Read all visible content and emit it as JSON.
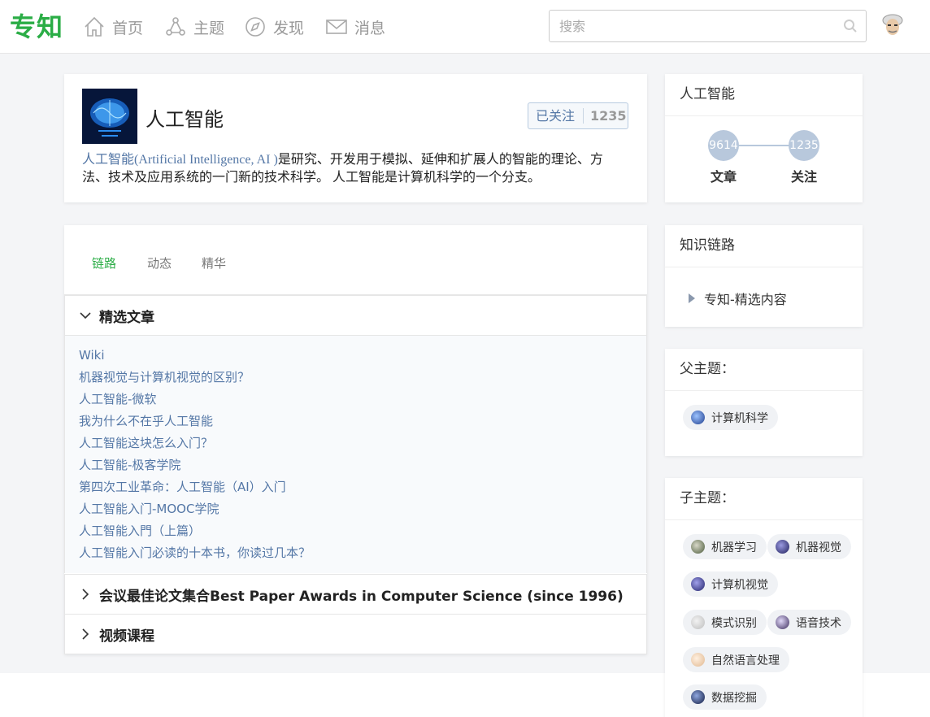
{
  "header": {
    "logo": "专知",
    "nav": [
      {
        "label": "首页",
        "icon": "home-icon"
      },
      {
        "label": "主题",
        "icon": "topic-icon"
      },
      {
        "label": "发现",
        "icon": "compass-icon"
      },
      {
        "label": "消息",
        "icon": "mail-icon"
      }
    ],
    "search": {
      "placeholder": "搜索",
      "value": ""
    }
  },
  "topic": {
    "title": "人工智能",
    "follow_label": "已关注",
    "follow_count": "1235",
    "desc_link": "人工智能",
    "desc_link_en": "(Artificial Intelligence, AI )",
    "desc_rest": "是研究、开发用于模拟、延伸和扩展人的智能的理论、方法、技术及应用系统的一门新的技术科学。 人工智能是计算机科学的一个分支。"
  },
  "tabs": [
    {
      "label": "链路",
      "active": true
    },
    {
      "label": "动态",
      "active": false
    },
    {
      "label": "精华",
      "active": false
    }
  ],
  "sections": [
    {
      "title": "精选文章",
      "expanded": true,
      "items": [
        "Wiki",
        "机器视觉与计算机视觉的区别？",
        "人工智能-微软",
        "我为什么不在乎人工智能",
        "人工智能这块怎么入门？",
        "人工智能-极客学院",
        "第四次工业革命：人工智能（AI）入门",
        "人工智能入门-MOOC学院",
        "人工智能入門（上篇）",
        "人工智能入门必读的十本书，你读过几本？"
      ]
    },
    {
      "title": "会议最佳论文集合Best Paper Awards in Computer Science (since 1996)",
      "expanded": false
    },
    {
      "title": "视频课程",
      "expanded": false
    }
  ],
  "sidebar": {
    "stats_card": {
      "title": "人工智能",
      "articles_value": "9614",
      "articles_label": "文章",
      "follow_value": "1235",
      "follow_label": "关注"
    },
    "chain_card": {
      "title": "知识链路",
      "item": "专知-精选内容"
    },
    "parent_card": {
      "title": "父主题：",
      "chips": [
        {
          "label": "计算机科学",
          "color": "#3b5fa8"
        }
      ]
    },
    "child_card": {
      "title": "子主题：",
      "chips": [
        {
          "label": "机器学习",
          "color": "#6a7a5a"
        },
        {
          "label": "机器视觉",
          "color": "#3b3b8a"
        },
        {
          "label": "计算机视觉",
          "color": "#3b3b9a"
        },
        {
          "label": "模式识别",
          "color": "#cfcfcf"
        },
        {
          "label": "语音技术",
          "color": "#5a4a7a"
        },
        {
          "label": "自然语言处理",
          "color": "#e8c8a8"
        },
        {
          "label": "数据挖掘",
          "color": "#2a3a6a"
        }
      ]
    }
  },
  "colors": {
    "brand": "#2bad46",
    "link": "#5477a6"
  }
}
